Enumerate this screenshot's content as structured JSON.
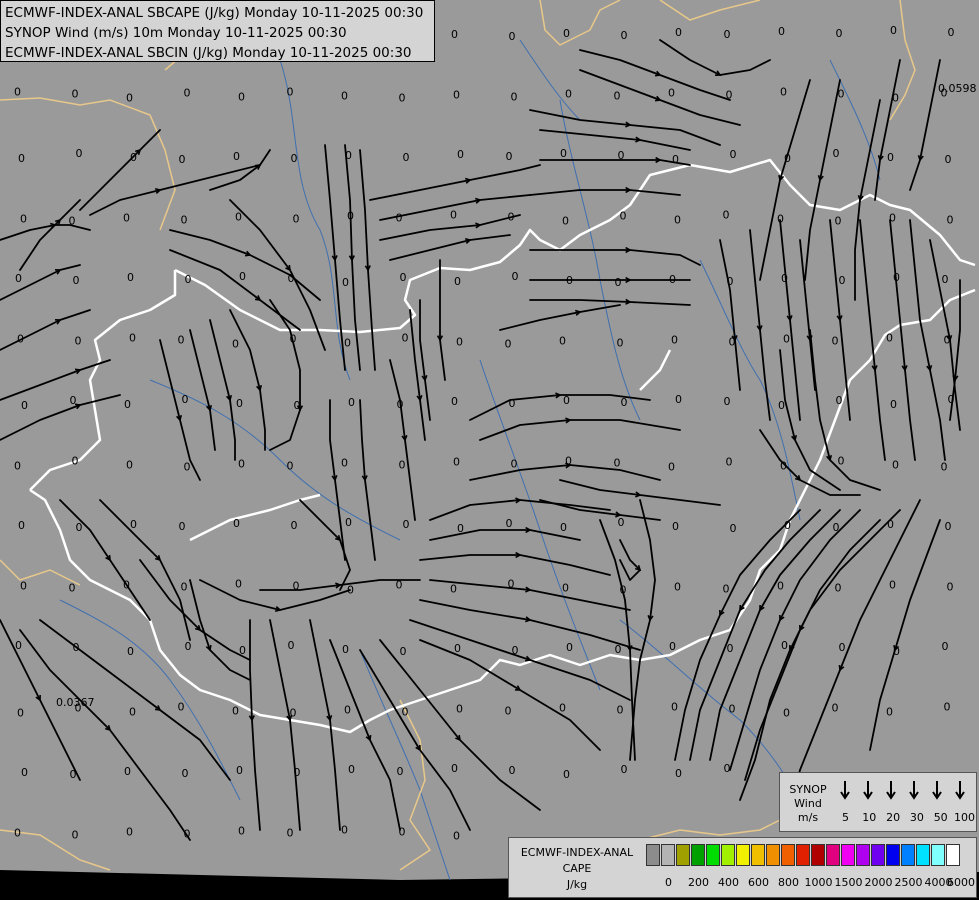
{
  "header": {
    "line1": "ECMWF-INDEX-ANAL SBCAPE (J/kg) Monday 10-11-2025 00:30",
    "line2": "SYNOP Wind (m/s) 10m Monday 10-11-2025 00:30",
    "line3": "ECMWF-INDEX-ANAL SBCIN (J/kg) Monday 10-11-2025 00:30"
  },
  "map": {
    "background_color": "#9a9a9a",
    "streamline_color": "#000000",
    "border_color_internal": "#ffffff",
    "border_color_external": "#e8c88a",
    "river_color": "#3f6fb0",
    "cape_values": {
      "zero_label": "0",
      "special_labels": [
        "0.0598",
        "0.0367"
      ]
    }
  },
  "synop_legend": {
    "title_line1": "SYNOP",
    "title_line2": "Wind",
    "title_line3": "m/s",
    "values": [
      "5",
      "10",
      "20",
      "30",
      "50",
      "100"
    ]
  },
  "cape_legend": {
    "title_line1": "ECMWF-INDEX-ANAL",
    "title_line2": "CAPE",
    "title_line3": "J/kg",
    "colors": [
      "#8c8c8c",
      "#b4b4b4",
      "#a0a000",
      "#00a000",
      "#00dc00",
      "#a0f000",
      "#f0f000",
      "#f0c000",
      "#f09000",
      "#f06000",
      "#e02000",
      "#b00000",
      "#e00080",
      "#f000f0",
      "#b000f0",
      "#7000f0",
      "#0000f0",
      "#0080ff",
      "#00e0ff",
      "#80ffff",
      "#ffffff"
    ],
    "ticks": [
      "0",
      "200",
      "400",
      "600",
      "800",
      "1000",
      "1500",
      "2000",
      "2500",
      "4000",
      "6000"
    ]
  }
}
